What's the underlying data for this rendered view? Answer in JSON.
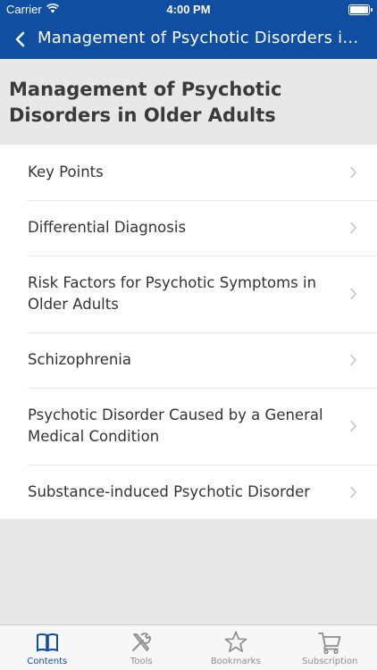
{
  "status_bar": {
    "carrier": "Carrier",
    "time": "4:00 PM"
  },
  "nav": {
    "title": "Management of Psychotic Disorders in..."
  },
  "header": {
    "title": "Management of Psychotic Disorders in Older Adults"
  },
  "list": {
    "items": [
      {
        "label": "Key Points"
      },
      {
        "label": "Differential Diagnosis"
      },
      {
        "label": "Risk Factors for Psychotic Symptoms in Older Adults"
      },
      {
        "label": "Schizophrenia"
      },
      {
        "label": "Psychotic Disorder Caused by a General Medical Condition"
      },
      {
        "label": "Substance-induced Psychotic Disorder"
      }
    ]
  },
  "tabs": [
    {
      "label": "Contents",
      "icon": "book-icon",
      "active": true
    },
    {
      "label": "Tools",
      "icon": "tools-icon",
      "active": false
    },
    {
      "label": "Bookmarks",
      "icon": "star-icon",
      "active": false
    },
    {
      "label": "Subscription",
      "icon": "cart-icon",
      "active": false
    }
  ],
  "colors": {
    "brand": "#0f4ea0",
    "inactive": "#8e8e93",
    "background": "#e8e8e8"
  }
}
